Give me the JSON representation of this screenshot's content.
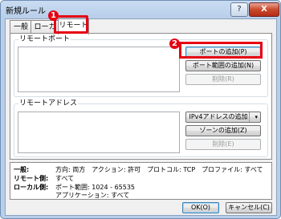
{
  "window": {
    "title": "新規ルール",
    "help_label": "?",
    "close_label": "X"
  },
  "tabs": [
    {
      "label": "一般"
    },
    {
      "label": "ローカル"
    },
    {
      "label": "リモート"
    }
  ],
  "remote_port": {
    "group_label": "リモートポート",
    "add_port_label": "ポートの追加(P)",
    "add_port_range_label": "ポート範囲の追加(N)",
    "delete_label": "削除(R)"
  },
  "remote_address": {
    "group_label": "リモートアドレス",
    "add_ipv4_label": "IPv4アドレスの追加",
    "add_zone_label": "ゾーンの追加(Z)",
    "delete_label": "削除(E)",
    "dropdown_arrow": "▾"
  },
  "summary": {
    "general_label": "一般:",
    "general_text": "方向: 両方　アクション: 許可　プロトコル: TCP　プロファイル: すべて",
    "remote_label": "リモート側:",
    "remote_text": "すべて",
    "local_label": "ローカル側:",
    "local_text": "ポート範囲: 1024 - 65535",
    "local_app_text": "アプリケーション: すべて"
  },
  "footer": {
    "ok_label": "OK(O)",
    "cancel_label": "キャンセル(C)"
  },
  "callouts": {
    "marker_1": "1",
    "marker_2": "2",
    "color": "#e60012"
  }
}
